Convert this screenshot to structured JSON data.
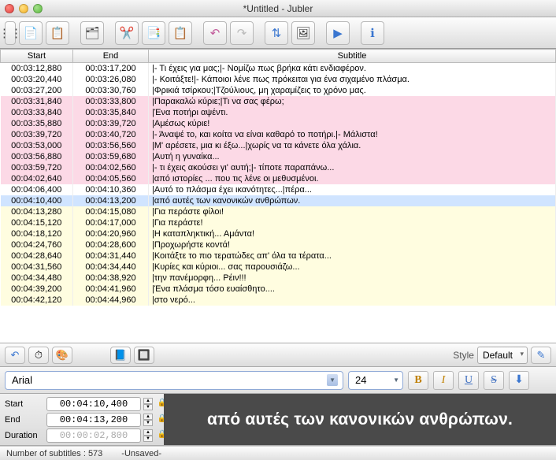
{
  "window": {
    "title": "*Untitled - Jubler"
  },
  "columns": {
    "start": "Start",
    "end": "End",
    "subtitle": "Subtitle"
  },
  "rows": [
    {
      "s": "00:03:12,880",
      "e": "00:03:17,200",
      "t": "|- Τι έχεις για μας;|- Νομίζω πως βρήκα κάτι ενδιαφέρον.",
      "c": ""
    },
    {
      "s": "00:03:20,440",
      "e": "00:03:26,080",
      "t": "|- Κοιτάξτε!|- Κάποιοι λένε πως πρόκειται για ένα σιχαμένο πλάσμα.",
      "c": ""
    },
    {
      "s": "00:03:27,200",
      "e": "00:03:30,760",
      "t": "|Φρικιά τσίρκου;|Τζούλιους, μη χαραμίζεις το χρόνο μας.",
      "c": ""
    },
    {
      "s": "00:03:31,840",
      "e": "00:03:33,800",
      "t": "|Παρακαλώ κύριε;|Τι να σας φέρω;",
      "c": "pink"
    },
    {
      "s": "00:03:33,840",
      "e": "00:03:35,840",
      "t": "|Ένα ποτήρι αψέντι.",
      "c": "pink"
    },
    {
      "s": "00:03:35,880",
      "e": "00:03:39,720",
      "t": "|Αμέσως κύριε!",
      "c": "pink"
    },
    {
      "s": "00:03:39,720",
      "e": "00:03:40,720",
      "t": "|- Άναψέ το, και κοίτα να είναι καθαρό το ποτήρι.|- Μάλιστα!",
      "c": "pink"
    },
    {
      "s": "00:03:53,000",
      "e": "00:03:56,560",
      "t": "|Μ' αρέσετε, μια κι έξω...|χωρίς να τα κάνετε όλα χάλια.",
      "c": "pink"
    },
    {
      "s": "00:03:56,880",
      "e": "00:03:59,680",
      "t": "|Αυτή η γυναίκα...",
      "c": "pink"
    },
    {
      "s": "00:03:59,720",
      "e": "00:04:02,560",
      "t": "|- τι έχεις ακούσει γι' αυτή;|- τίποτε παραπάνω...",
      "c": "pink"
    },
    {
      "s": "00:04:02,640",
      "e": "00:04:05,560",
      "t": "|από ιστορίες ... που τις λένε οι μεθυσμένοι.",
      "c": "pink"
    },
    {
      "s": "00:04:06,400",
      "e": "00:04:10,360",
      "t": "|Αυτό το πλάσμα έχει ικανότητες...|πέρα...",
      "c": ""
    },
    {
      "s": "00:04:10,400",
      "e": "00:04:13,200",
      "t": "|από αυτές των κανονικών ανθρώπων.",
      "c": "blue"
    },
    {
      "s": "00:04:13,280",
      "e": "00:04:15,080",
      "t": "|Για περάστε φίλοι!",
      "c": "yellow"
    },
    {
      "s": "00:04:15,120",
      "e": "00:04:17,000",
      "t": "|Για περάστε!",
      "c": "yellow"
    },
    {
      "s": "00:04:18,120",
      "e": "00:04:20,960",
      "t": "|Η καταπληκτική... Αμάντα!",
      "c": "yellow"
    },
    {
      "s": "00:04:24,760",
      "e": "00:04:28,600",
      "t": "|Προχωρήστε κοντά!",
      "c": "yellow"
    },
    {
      "s": "00:04:28,640",
      "e": "00:04:31,440",
      "t": "|Κοιτάξτε το πιο τερατώδες απ' όλα τα τέρατα...",
      "c": "yellow"
    },
    {
      "s": "00:04:31,560",
      "e": "00:04:34,440",
      "t": "|Κυρίες και κύριοι... σας παρουσιάζω...",
      "c": "yellow"
    },
    {
      "s": "00:04:34,480",
      "e": "00:04:38,920",
      "t": "|την πανέμορφη... Ρέιν!!!",
      "c": "yellow"
    },
    {
      "s": "00:04:39,200",
      "e": "00:04:41,960",
      "t": "|Ένα πλάσμα τόσο ευαίσθητο....",
      "c": "yellow"
    },
    {
      "s": "00:04:42,120",
      "e": "00:04:44,960",
      "t": "|στο νερό...",
      "c": "yellow"
    }
  ],
  "style": {
    "label": "Style",
    "value": "Default"
  },
  "font": {
    "family": "Arial",
    "size": "24"
  },
  "format": {
    "bold": "B",
    "italic": "I",
    "underline": "U",
    "strike": "S"
  },
  "timing": {
    "start_label": "Start",
    "end_label": "End",
    "dur_label": "Duration",
    "start": "00:04:10,400",
    "end": "00:04:13,200",
    "duration": "00:00:02,800"
  },
  "preview": {
    "text": "από αυτές των κανονικών ανθρώπων."
  },
  "status": {
    "count_label": "Number of subtitles :",
    "count": "573",
    "saved": "-Unsaved-"
  },
  "icons": {
    "new": "📄",
    "save": "💾",
    "child": "📋",
    "reparent": "🗂",
    "cut": "✂️",
    "copy": "📑",
    "paste": "📋",
    "undo": "↶",
    "redo": "↷",
    "sort": "⇅",
    "preview": "🖼",
    "play": "▶",
    "info": "ℹ",
    "back": "↶",
    "tool1": "⏱",
    "tool2": "🎨",
    "tool3": "📘",
    "tool4": "🔲",
    "edit": "✎",
    "down": "⬇",
    "lock": "🔒"
  }
}
